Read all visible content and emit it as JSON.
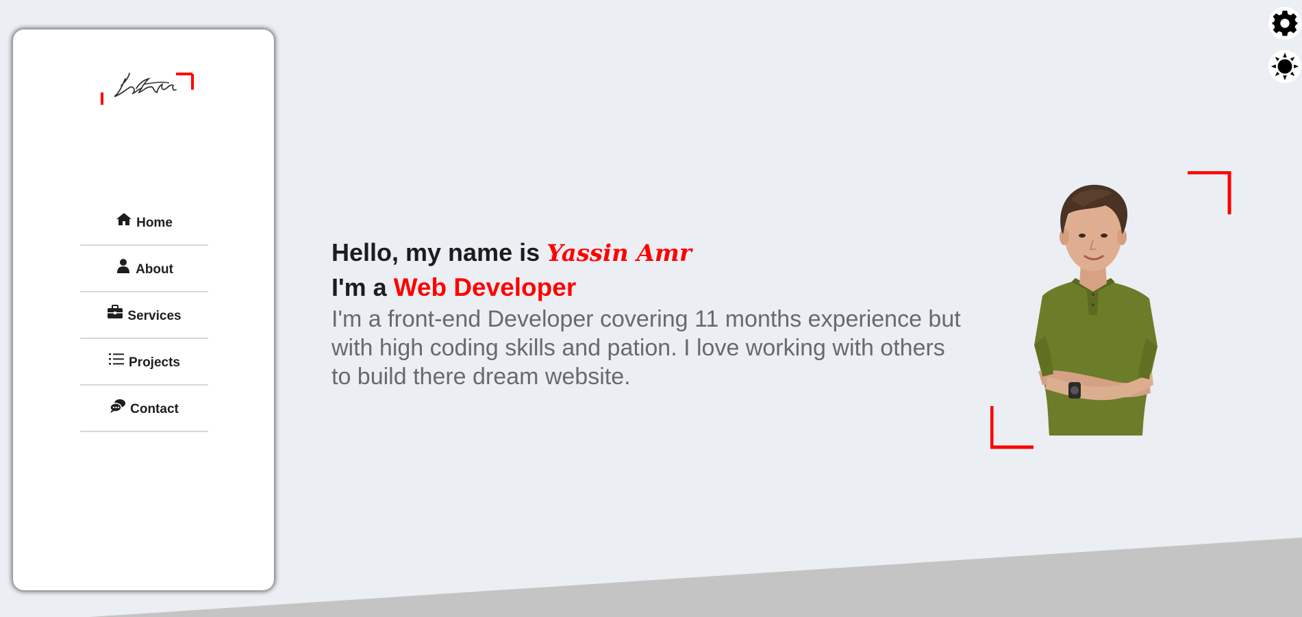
{
  "logo": {
    "icon": "signature-logo-icon",
    "accent_color": "#ff0000"
  },
  "nav": {
    "items": [
      {
        "label": "Home",
        "icon": "home-icon"
      },
      {
        "label": "About",
        "icon": "user-icon"
      },
      {
        "label": "Services",
        "icon": "briefcase-icon"
      },
      {
        "label": "Projects",
        "icon": "list-icon"
      },
      {
        "label": "Contact",
        "icon": "chat-icon"
      }
    ]
  },
  "hero": {
    "greeting": "Hello, my name is ",
    "name": "Yassin Amr",
    "role_prefix": "I'm a ",
    "role": "Web Developer",
    "description": "I'm a front-end Developer covering 11 months experience but with high coding skills and pation. I love working with others to build there dream website."
  },
  "portrait": {
    "icon": "profile-photo",
    "frame_color": "#ff0000"
  },
  "toolbar": {
    "settings_icon": "gear-icon",
    "theme_icon": "sun-icon"
  },
  "colors": {
    "accent": "#ff0000",
    "background": "#ebeef3",
    "sidebar": "#ffffff",
    "slope": "#c4c4c4",
    "text_dark": "#1c1c1c",
    "text_muted": "#666a70"
  }
}
